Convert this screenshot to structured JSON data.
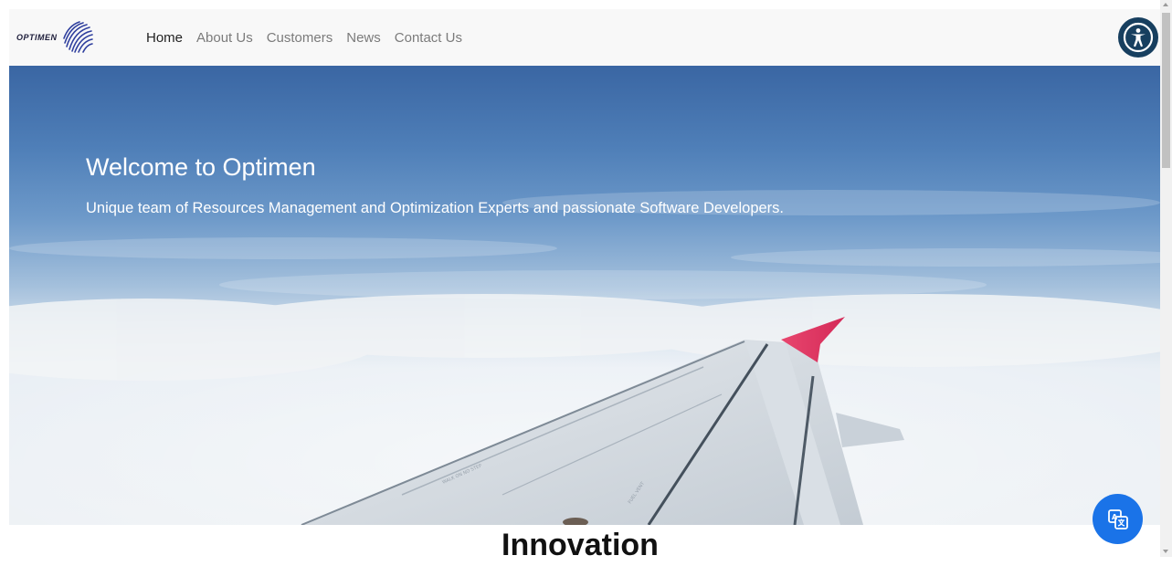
{
  "brand": {
    "name": "OPTIMEN",
    "logo_icon": "spiral-globe-logo"
  },
  "nav": {
    "items": [
      {
        "label": "Home",
        "active": true
      },
      {
        "label": "About Us",
        "active": false
      },
      {
        "label": "Customers",
        "active": false
      },
      {
        "label": "News",
        "active": false
      },
      {
        "label": "Contact Us",
        "active": false
      }
    ]
  },
  "accessibility": {
    "icon": "accessibility-icon",
    "color": "#173f5f"
  },
  "hero": {
    "title": "Welcome to Optimen",
    "subtitle": "Unique team of Resources Management and Optimization Experts and passionate Software Developers.",
    "image": "airplane-wing-above-clouds"
  },
  "section": {
    "heading": "Innovation"
  },
  "translate": {
    "icon": "translate-icon",
    "color": "#1a73e8"
  }
}
